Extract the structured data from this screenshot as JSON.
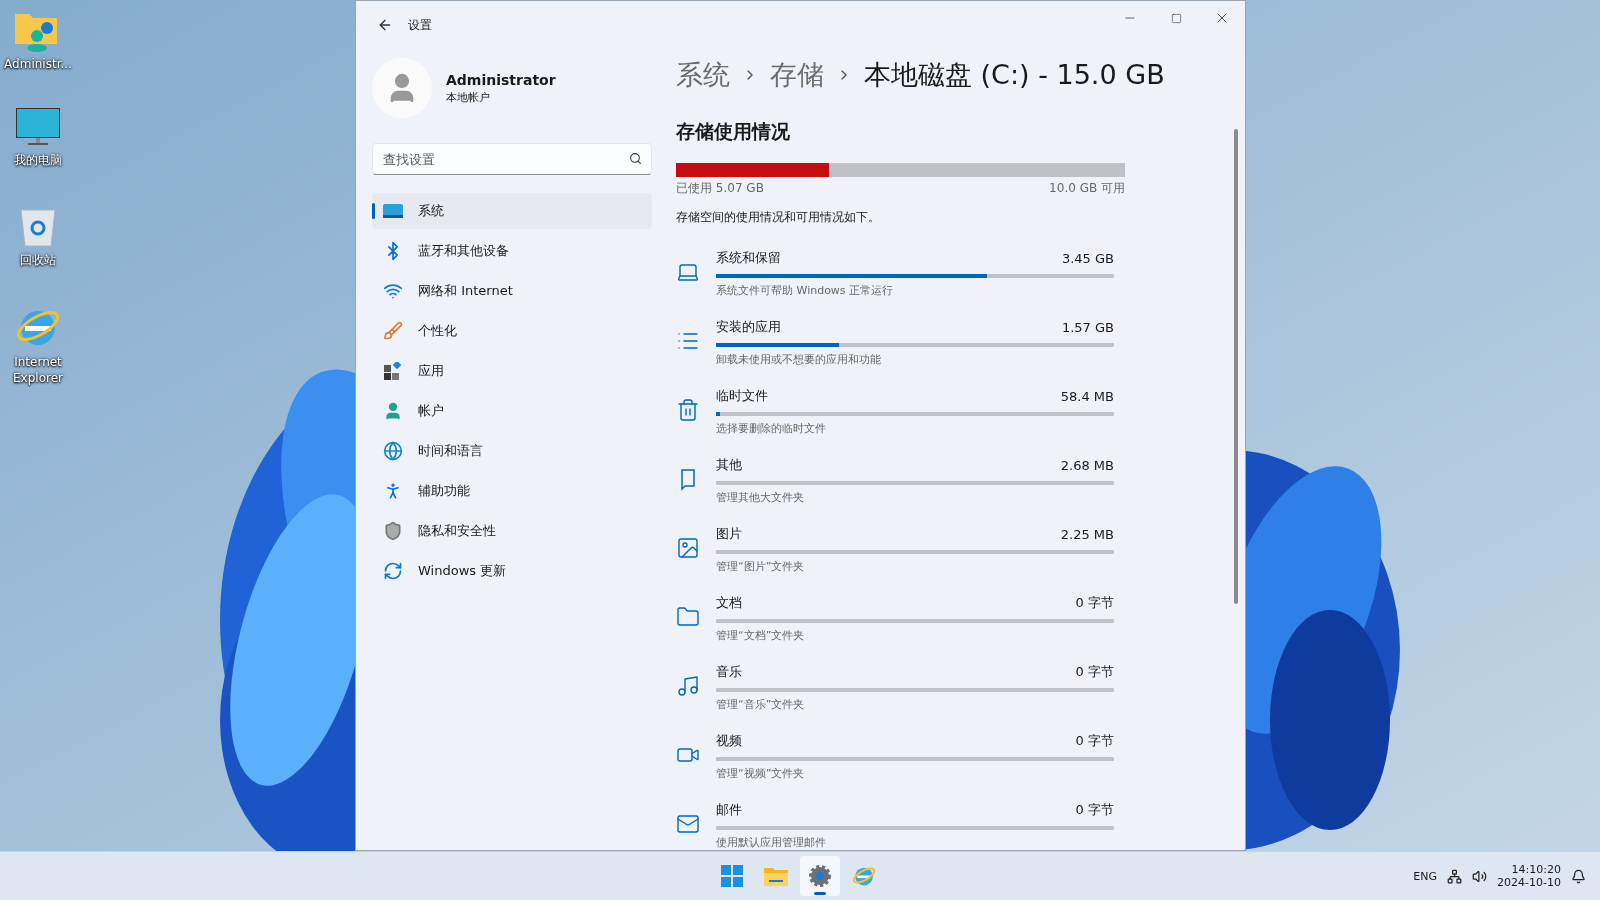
{
  "desktop": {
    "icons": [
      {
        "label": "Administr..."
      },
      {
        "label": "我的电脑"
      },
      {
        "label": "回收站"
      },
      {
        "label": "Internet Explorer"
      }
    ]
  },
  "window": {
    "title": "设置",
    "profile": {
      "name": "Administrator",
      "account_type": "本地帐户"
    },
    "search": {
      "placeholder": "查找设置"
    },
    "nav": [
      {
        "label": "系统",
        "selected": true
      },
      {
        "label": "蓝牙和其他设备",
        "selected": false
      },
      {
        "label": "网络和 Internet",
        "selected": false
      },
      {
        "label": "个性化",
        "selected": false
      },
      {
        "label": "应用",
        "selected": false
      },
      {
        "label": "帐户",
        "selected": false
      },
      {
        "label": "时间和语言",
        "selected": false
      },
      {
        "label": "辅助功能",
        "selected": false
      },
      {
        "label": "隐私和安全性",
        "selected": false
      },
      {
        "label": "Windows 更新",
        "selected": false
      }
    ],
    "breadcrumb": [
      "系统",
      "存储",
      "本地磁盘 (C:) - 15.0 GB"
    ],
    "section_title": "存储使用情况",
    "usage": {
      "level": 0.34,
      "used": "已使用 5.07 GB",
      "free": "10.0 GB 可用"
    },
    "description": "存储空间的使用情况和可用情况如下。",
    "categories": [
      {
        "name": "系统和保留",
        "size": "3.45 GB",
        "level": 0.68,
        "hint": "系统文件可帮助 Windows 正常运行"
      },
      {
        "name": "安装的应用",
        "size": "1.57 GB",
        "level": 0.31,
        "hint": "卸载未使用或不想要的应用和功能"
      },
      {
        "name": "临时文件",
        "size": "58.4 MB",
        "level": 0.01,
        "hint": "选择要删除的临时文件"
      },
      {
        "name": "其他",
        "size": "2.68 MB",
        "hint": "管理其他大文件夹"
      },
      {
        "name": "图片",
        "size": "2.25 MB",
        "hint": "管理“图片”文件夹"
      },
      {
        "name": "文档",
        "size": "0 字节",
        "hint": "管理“文档”文件夹"
      },
      {
        "name": "音乐",
        "size": "0 字节",
        "hint": "管理“音乐”文件夹"
      },
      {
        "name": "视频",
        "size": "0 字节",
        "hint": "管理“视频”文件夹"
      },
      {
        "name": "邮件",
        "size": "0 字节",
        "hint": "使用默认应用管理邮件"
      }
    ]
  },
  "taskbar": {
    "apps": [
      {
        "selected": false
      },
      {
        "selected": false
      },
      {
        "selected": true
      },
      {
        "selected": false
      }
    ],
    "tray": {
      "language": "ENG",
      "time": "14:10:20",
      "date": "2024-10-10"
    }
  }
}
